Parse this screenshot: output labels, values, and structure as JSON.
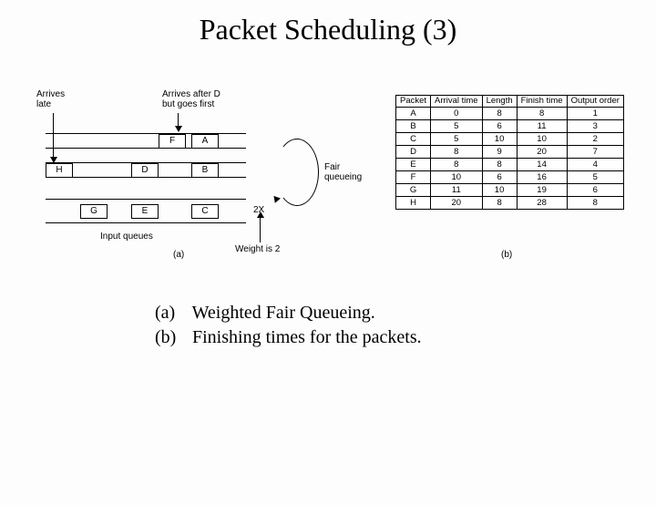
{
  "title": "Packet Scheduling (3)",
  "annotations": {
    "arrives_late": "Arrives\nlate",
    "arrives_after_d": "Arrives after D\nbut goes first",
    "fair_queueing": "Fair\nqueueing",
    "weight_2x": "2X",
    "weight_is_2": "Weight is 2",
    "input_queues": "Input queues",
    "fig_a": "(a)",
    "fig_b": "(b)"
  },
  "queues": {
    "lane1": [
      "F",
      "A"
    ],
    "lane2": [
      "H",
      "D",
      "B"
    ],
    "lane3": [
      "G",
      "E",
      "C"
    ]
  },
  "chart_data": {
    "type": "table",
    "headers": [
      "Packet",
      "Arrival time",
      "Length",
      "Finish time",
      "Output order"
    ],
    "rows": [
      [
        "A",
        "0",
        "8",
        "8",
        "1"
      ],
      [
        "B",
        "5",
        "6",
        "11",
        "3"
      ],
      [
        "C",
        "5",
        "10",
        "10",
        "2"
      ],
      [
        "D",
        "8",
        "9",
        "20",
        "7"
      ],
      [
        "E",
        "8",
        "8",
        "14",
        "4"
      ],
      [
        "F",
        "10",
        "6",
        "16",
        "5"
      ],
      [
        "G",
        "11",
        "10",
        "19",
        "6"
      ],
      [
        "H",
        "20",
        "8",
        "28",
        "8"
      ]
    ]
  },
  "captions": {
    "a_label": "(a)",
    "a_text": "Weighted Fair Queueing.",
    "b_label": "(b)",
    "b_text": "Finishing times for the packets."
  }
}
